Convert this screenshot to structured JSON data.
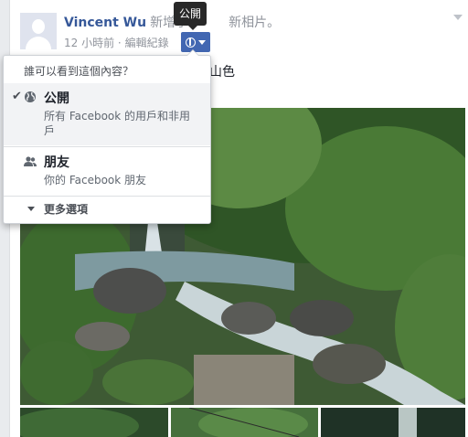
{
  "post": {
    "author": "Vincent Wu",
    "action": "新增了",
    "action_rest": "新相片。",
    "timestamp": "12 小時前",
    "dot": "·",
    "edit_history": "編輯紀錄",
    "text": "山色"
  },
  "tooltip": {
    "label": "公開"
  },
  "privacy_menu": {
    "heading": "誰可以看到這個內容？",
    "options": [
      {
        "check": "✔",
        "title": "公開",
        "description": "所有 Facebook 的用戶和非用戶",
        "icon": "globe-icon",
        "selected": true
      },
      {
        "check": "",
        "title": "朋友",
        "description": "你的 Facebook 朋友",
        "icon": "friends-icon",
        "selected": false
      }
    ],
    "more": "更多選項"
  },
  "colors": {
    "link_blue": "#365899",
    "button_blue": "#4267b2",
    "tooltip_bg": "#282828"
  }
}
